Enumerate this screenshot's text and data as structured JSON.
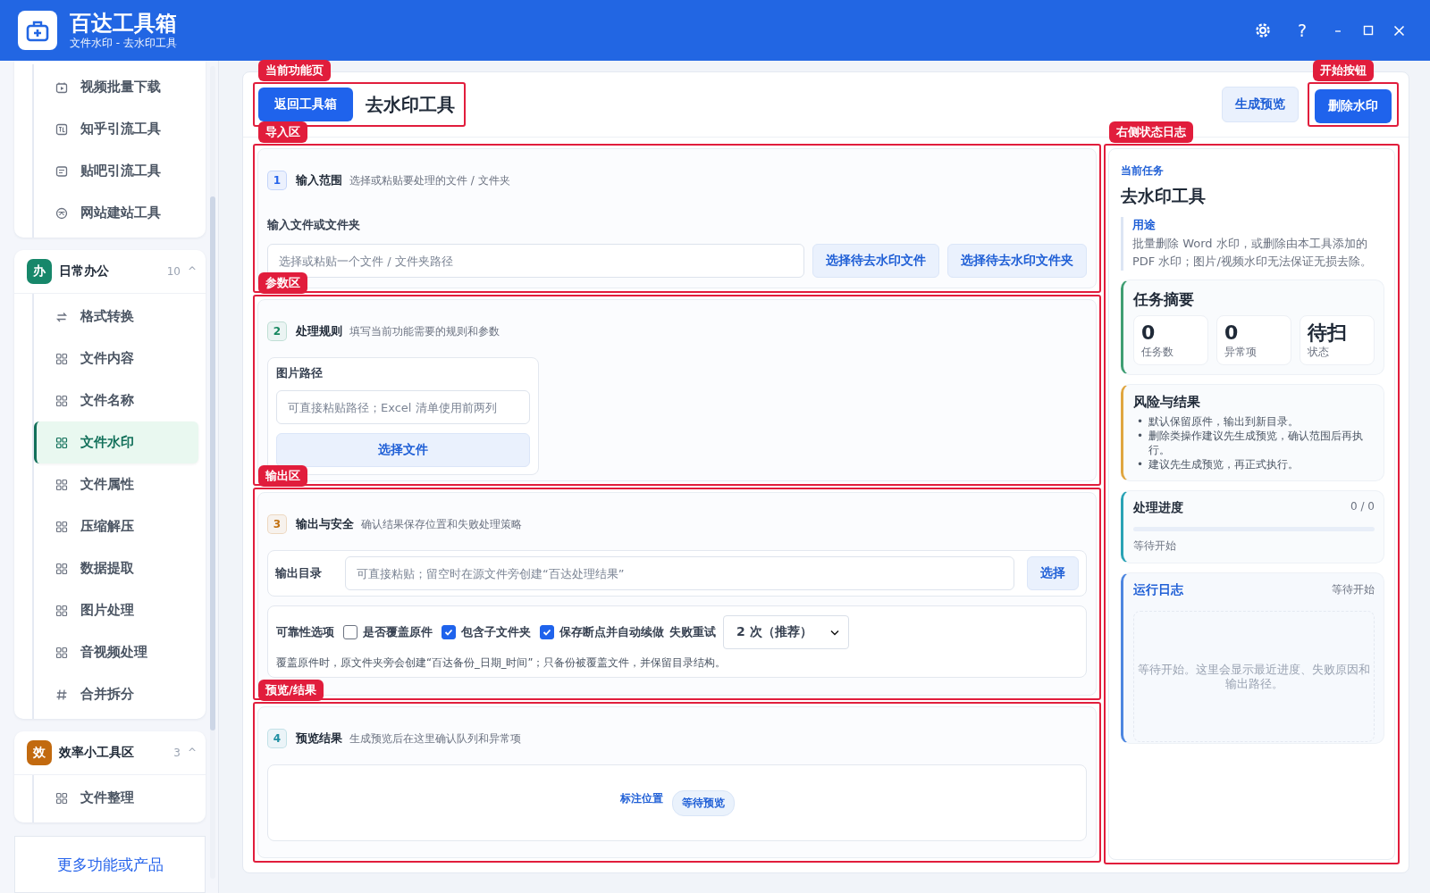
{
  "app": {
    "title": "百达工具箱",
    "subtitle": "文件水印 - 去水印工具",
    "help": "?"
  },
  "sidebar": {
    "groups": [
      {
        "items": [
          {
            "label": "视频批量下载",
            "kind": "video",
            "selected": false
          },
          {
            "label": "知乎引流工具",
            "kind": "zhihu",
            "selected": false
          },
          {
            "label": "贴吧引流工具",
            "kind": "tieba",
            "selected": false
          },
          {
            "label": "网站建站工具",
            "kind": "web",
            "selected": false
          }
        ]
      },
      {
        "badge": "办",
        "color": "#17876a",
        "title": "日常办公",
        "count": "10",
        "toggle": "^",
        "items": [
          {
            "label": "格式转换",
            "kind": "convert",
            "selected": false
          },
          {
            "label": "文件内容",
            "kind": "tool",
            "selected": false
          },
          {
            "label": "文件名称",
            "kind": "tool",
            "selected": false
          },
          {
            "label": "文件水印",
            "kind": "tool",
            "selected": true
          },
          {
            "label": "文件属性",
            "kind": "tool",
            "selected": false
          },
          {
            "label": "压缩解压",
            "kind": "tool",
            "selected": false
          },
          {
            "label": "数据提取",
            "kind": "tool",
            "selected": false
          },
          {
            "label": "图片处理",
            "kind": "tool",
            "selected": false
          },
          {
            "label": "音视频处理",
            "kind": "tool",
            "selected": false
          },
          {
            "label": "合并拆分",
            "kind": "split",
            "selected": false
          }
        ]
      },
      {
        "badge": "效",
        "color": "#c26a0f",
        "title": "效率小工具区",
        "count": "3",
        "toggle": "^",
        "items": [
          {
            "label": "文件整理",
            "kind": "tool",
            "selected": false
          }
        ]
      }
    ],
    "footer_link": "更多功能或产品"
  },
  "page": {
    "annotation": "当前功能页",
    "back_button": "返回工具箱",
    "title": "去水印工具",
    "preview_button": "生成预览",
    "start_annotation": "开始按钮",
    "start_button": "删除水印"
  },
  "sections": [
    {
      "kind": "input",
      "annotation": "导入区",
      "step": "1",
      "color": "#2563eb",
      "title": "输入范围",
      "description": "选择或粘贴要处理的文件 / 文件夹",
      "field_label": "输入文件或文件夹",
      "placeholder": "选择或粘贴一个文件 / 文件夹路径",
      "buttons": [
        "选择待去水印文件",
        "选择待去水印文件夹"
      ]
    },
    {
      "kind": "rules",
      "annotation": "参数区",
      "step": "2",
      "color": "#16875f",
      "title": "处理规则",
      "description": "填写当前功能需要的规则和参数",
      "field_label": "图片路径",
      "placeholder": "可直接粘贴路径；Excel 清单使用前两列",
      "buttons": [
        "选择文件"
      ]
    },
    {
      "kind": "output",
      "annotation": "输出区",
      "step": "3",
      "color": "#c2700f",
      "title": "输出与安全",
      "description": "确认结果保存位置和失败处理策略",
      "field_label": "输出目录",
      "placeholder": "可直接粘贴；留空时在源文件旁创建“百达处理结果”",
      "buttons": [
        "选择"
      ],
      "options_label": "可靠性选项",
      "options": [
        {
          "label": "是否覆盖原件",
          "checked": false
        },
        {
          "label": "包含子文件夹",
          "checked": true
        },
        {
          "label": "保存断点并自动续做",
          "checked": true
        }
      ],
      "retry_label": "失败重试",
      "retry_value": "2 次（推荐）",
      "note": "覆盖原件时，原文件夹旁会创建“百达备份_日期_时间”；只备份被覆盖文件，并保留目录结构。"
    },
    {
      "kind": "preview",
      "annotation": "预览/结果",
      "step": "4",
      "color": "#1f8fa3",
      "title": "预览结果",
      "description": "生成预览后在这里确认队列和异常项",
      "link": "标注位置",
      "pill": "等待预览"
    }
  ],
  "status_panel": {
    "annotation": "右侧状态日志",
    "eyebrow": "当前任务",
    "title": "去水印工具",
    "purpose_label": "用途",
    "purpose": "批量删除 Word 水印，或删除由本工具添加的 PDF 水印；图片/视频水印无法保证无损去除。",
    "summary": {
      "title": "任务摘要",
      "stats": [
        {
          "value": "0",
          "label": "任务数"
        },
        {
          "value": "0",
          "label": "异常项"
        },
        {
          "value": "待扫",
          "label": "状态"
        }
      ]
    },
    "risks": {
      "title": "风险与结果",
      "marker": "•",
      "items": [
        "默认保留原件，输出到新目录。",
        "删除类操作建议先生成预览，确认范围后再执行。",
        "建议先生成预览，再正式执行。"
      ]
    },
    "progress": {
      "title": "处理进度",
      "count": "0 / 0",
      "level": 0,
      "status": "等待开始"
    },
    "log": {
      "title": "运行日志",
      "status": "等待开始",
      "placeholder": "等待开始。这里会显示最近进度、失败原因和输出路径。"
    }
  }
}
